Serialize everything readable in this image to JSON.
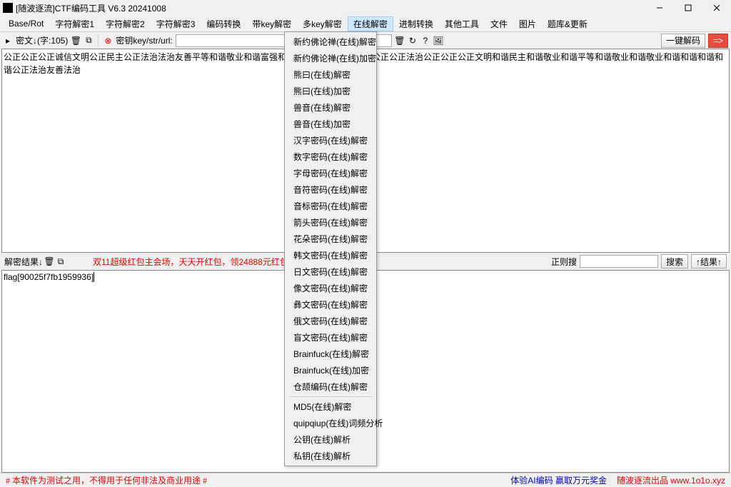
{
  "window": {
    "title": "[随波逐流]CTF编码工具 V6.3 20241008"
  },
  "menu": {
    "items": [
      "Base/Rot",
      "字符解密1",
      "字符解密2",
      "字符解密3",
      "编码转换",
      "带key解密",
      "多key解密",
      "在线解密",
      "进制转换",
      "其他工具",
      "文件",
      "图片",
      "题库&更新"
    ],
    "active_index": 7
  },
  "toolbar": {
    "cipher_label": "密文↓(字:105)",
    "key_label": "密钥key/str/url:",
    "key_value": "",
    "one_click": "一键解码"
  },
  "content": {
    "cipher": "公正公正公正诚信文明公正民主公正法治法治友善平等和谐敬业和谐富强和谐强和谐和谐公正公正公正公正法治公正公正公正文明和谐民主和谐敬业和谐平等和谐敬业和谐敬业和谐和谐和谐和谐公正法治友善法治",
    "result": "flag[90025f7fb1959936]"
  },
  "midbar": {
    "label_left": "解密结果↓",
    "promo": "双11超级红包主会场，天天开红包，领24888元红包！",
    "regex_label": "正则搜",
    "search_btn": "搜索",
    "result_btn": "↑结果↑"
  },
  "dropdown": {
    "items1": [
      "新约佛论禅(在线)解密",
      "新约佛论禅(在线)加密",
      "熊曰(在线)解密",
      "熊曰(在线)加密",
      "兽音(在线)解密",
      "兽音(在线)加密",
      "汉字密码(在线)解密",
      "数字密码(在线)解密",
      "字母密码(在线)解密",
      "音符密码(在线)解密",
      "音标密码(在线)解密",
      "箭头密码(在线)解密",
      "花朵密码(在线)解密",
      "韩文密码(在线)解密",
      "日文密码(在线)解密",
      "像文密码(在线)解密",
      "彝文密码(在线)解密",
      "俄文密码(在线)解密",
      "盲文密码(在线)解密",
      "Brainfuck(在线)解密",
      "Brainfuck(在线)加密",
      "仓颉编码(在线)解密"
    ],
    "items2": [
      "MD5(在线)解密",
      "quipqiup(在线)词频分析",
      "公钥(在线)解析",
      "私钥(在线)解析"
    ]
  },
  "status": {
    "left": "# 本软件为测试之用，不得用于任何非法及商业用途 #",
    "right1": "体验AI编码 赢取万元奖金",
    "right2": "随波逐流出品  www.1o1o.xyz"
  }
}
